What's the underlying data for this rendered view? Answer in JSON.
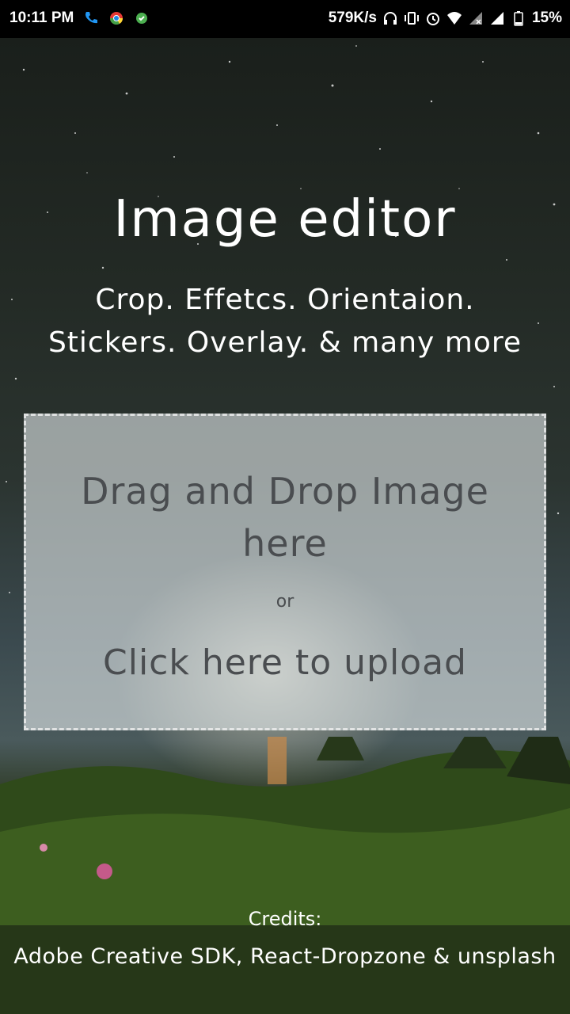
{
  "status_bar": {
    "time": "10:11 PM",
    "network_speed": "579K/s",
    "battery": "15%",
    "left_icons": [
      "phone-icon",
      "chrome-icon",
      "app-icon"
    ],
    "right_icons": [
      "headphones-icon",
      "vibrate-icon",
      "alarm-icon",
      "wifi-icon",
      "signal-no-sim-icon",
      "signal-icon",
      "battery-icon"
    ]
  },
  "header": {
    "title": "Image editor",
    "subtitle_line1": "Crop. Effetcs. Orientaion.",
    "subtitle_line2": "Stickers. Overlay. & many more"
  },
  "dropzone": {
    "main_text": "Drag and Drop Image here",
    "or_text": "or",
    "upload_text": "Click here to upload"
  },
  "footer": {
    "credits_title": "Credits:",
    "credits_text": "Adobe Creative SDK, React-Dropzone & unsplash"
  },
  "colors": {
    "status_bar_bg": "#000000",
    "text_light": "#ffffff",
    "dropzone_text": "#4a4d50",
    "dropzone_border": "#f0f0f0"
  }
}
